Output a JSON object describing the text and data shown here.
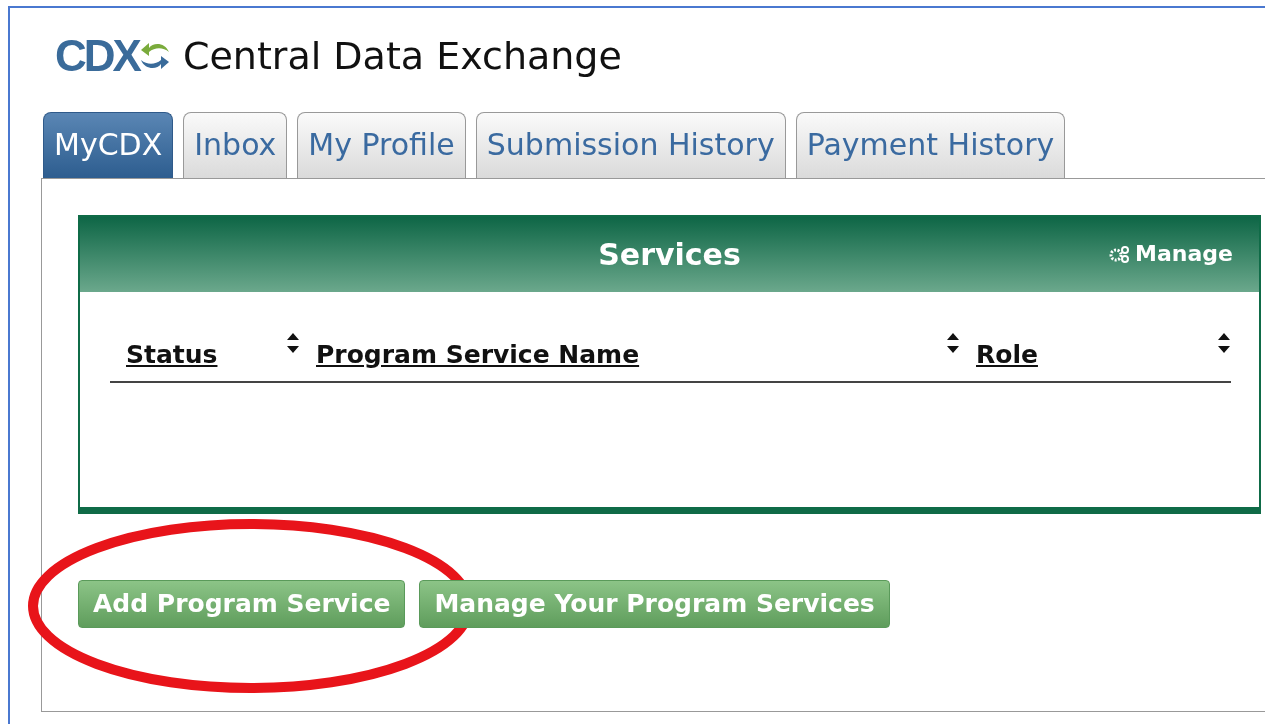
{
  "header": {
    "logo": "CDX",
    "title": "Central Data Exchange"
  },
  "tabs": [
    {
      "label": "MyCDX",
      "selected": true
    },
    {
      "label": "Inbox",
      "selected": false
    },
    {
      "label": "My Profile",
      "selected": false
    },
    {
      "label": "Submission History",
      "selected": false
    },
    {
      "label": "Payment History",
      "selected": false
    }
  ],
  "services_panel": {
    "title": "Services",
    "manage_link": "Manage",
    "columns": [
      {
        "label": "Status"
      },
      {
        "label": "Program Service Name"
      },
      {
        "label": "Role"
      }
    ]
  },
  "buttons": [
    {
      "label": "Add Program Service",
      "highlighted": true
    },
    {
      "label": "Manage Your Program Services",
      "highlighted": false
    }
  ]
}
